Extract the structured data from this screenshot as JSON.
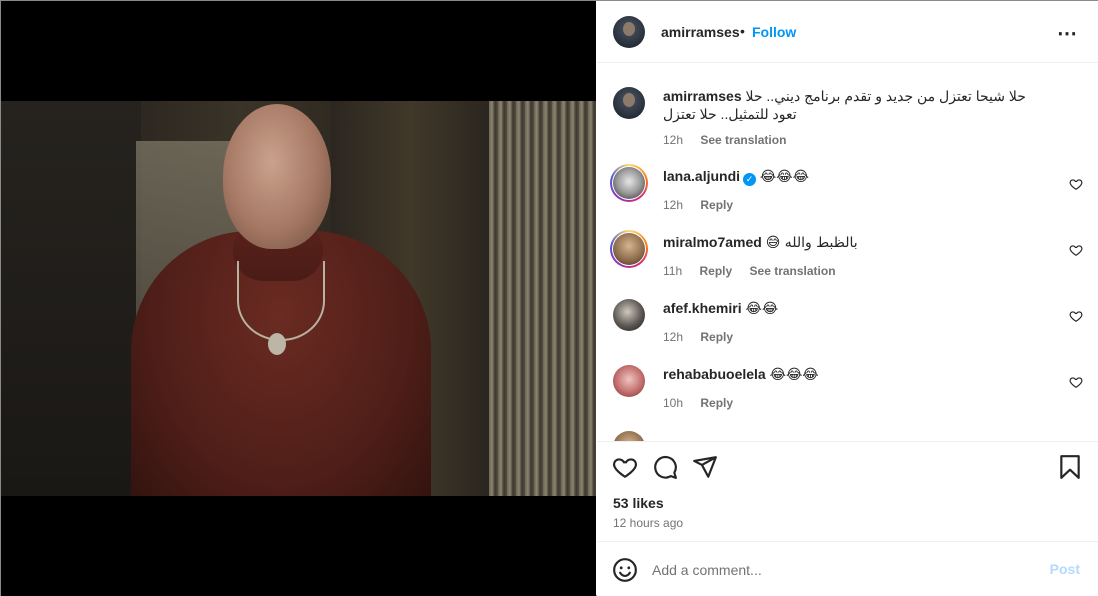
{
  "post": {
    "author": "amirramses",
    "follow_label": "Follow",
    "dot": "•",
    "more_icon": "⋯",
    "caption": {
      "username": "amirramses",
      "text": "حلا شيحا تعتزل من جديد و تقدم برنامج ديني.. حلا تعود للتمثيل.. حلا تعتزل",
      "time": "12h",
      "translate_label": "See translation"
    },
    "likes": "53 likes",
    "posted_ago": "12 hours ago"
  },
  "comments": [
    {
      "username": "lana.aljundi",
      "verified": true,
      "text": "😂😂😂",
      "time": "12h",
      "reply_label": "Reply",
      "translate_label": ""
    },
    {
      "username": "miralmo7amed",
      "verified": false,
      "text": "بالظبط والله 😅",
      "time": "11h",
      "reply_label": "Reply",
      "translate_label": "See translation"
    },
    {
      "username": "afef.khemiri",
      "verified": false,
      "text": "😂😂",
      "time": "12h",
      "reply_label": "Reply",
      "translate_label": ""
    },
    {
      "username": "rehababuoelela",
      "verified": false,
      "text": "😂😂😂",
      "time": "10h",
      "reply_label": "Reply",
      "translate_label": ""
    }
  ],
  "composer": {
    "placeholder": "Add a comment...",
    "post_label": "Post"
  },
  "colors": {
    "accent": "#0095f6",
    "post_disabled": "#b3dbff",
    "muted": "#737373"
  },
  "icons": [
    "heart-icon",
    "comment-icon",
    "share-icon",
    "bookmark-icon",
    "emoji-icon",
    "more-icon",
    "verified-icon"
  ]
}
